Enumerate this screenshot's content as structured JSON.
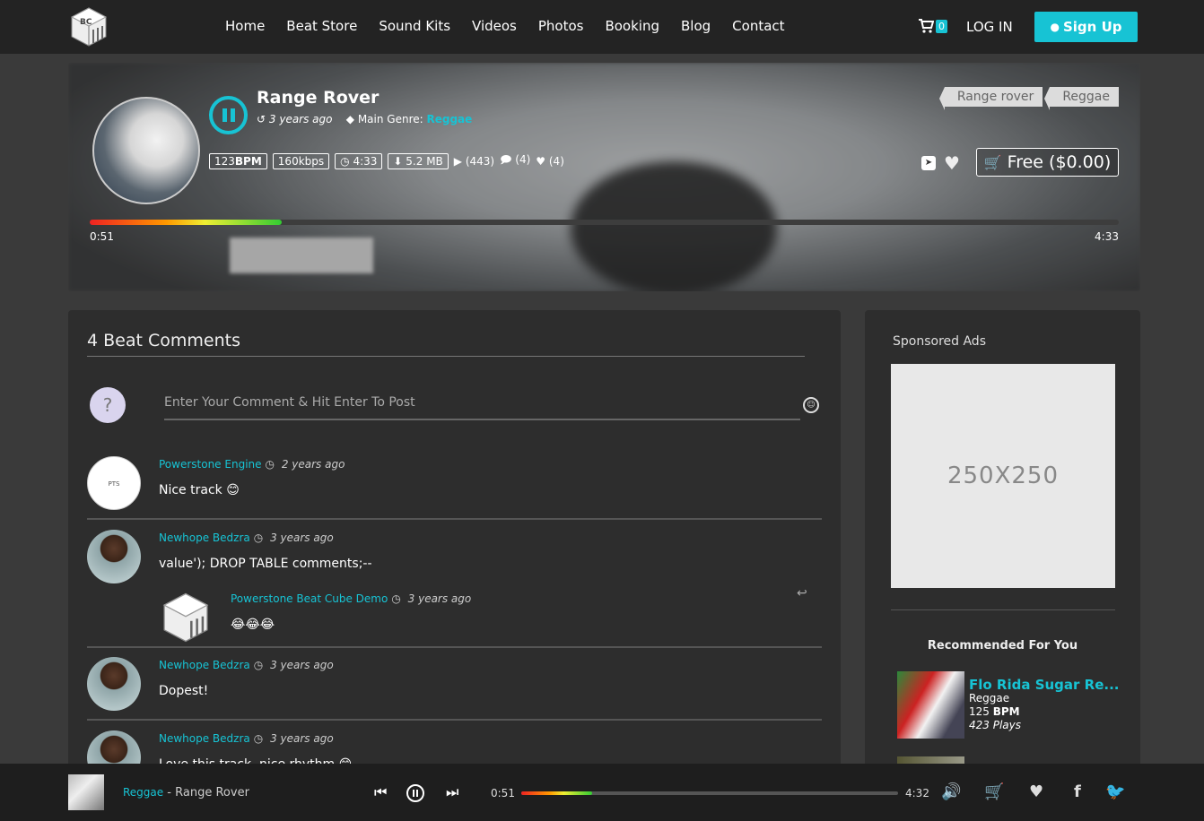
{
  "nav": {
    "links": [
      "Home",
      "Beat Store",
      "Sound Kits",
      "Videos",
      "Photos",
      "Booking",
      "Blog",
      "Contact"
    ],
    "cart_count": "0",
    "login": "LOG IN",
    "signup": "Sign Up",
    "logo_text": "BC"
  },
  "beat": {
    "title": "Range Rover",
    "ago": "3 years ago",
    "genre_label": "Main Genre:",
    "genre": "Reggae",
    "bpm_value": "123",
    "bpm_unit": "BPM",
    "bitrate": "160kbps",
    "duration": "4:33",
    "size": "5.2 MB",
    "plays": "(443)",
    "comments": "(4)",
    "likes": "(4)",
    "tags": [
      "Range rover",
      "Reggae"
    ],
    "price": "Free ($0.00)",
    "current_time": "0:51",
    "total_time": "4:33",
    "progress_fraction": 0.187
  },
  "comments": {
    "heading": "4 Beat Comments",
    "input_placeholder": "Enter Your Comment & Hit Enter To Post",
    "items": [
      {
        "name": "Powerstone Engine",
        "time": "2 years ago",
        "text": "Nice track 😊",
        "avatar": "PTS TECHNOLOGIES"
      },
      {
        "name": "Newhope Bedzra",
        "time": "3 years ago",
        "text": "value'); DROP TABLE comments;--"
      },
      {
        "name": "Newhope Bedzra",
        "time": "3 years ago",
        "text": "Dopest!"
      },
      {
        "name": "Newhope Bedzra",
        "time": "3 years ago",
        "text": "Love this track, nice rhythm 😊"
      }
    ],
    "reply": {
      "name": "Powerstone Beat Cube Demo",
      "time": "3 years ago",
      "text": "😂😂😂"
    }
  },
  "sidebar": {
    "ads_heading": "Sponsored Ads",
    "ad_text": "250X250",
    "rec_heading": "Recommended For You",
    "rec": {
      "title": "Flo Rida Sugar Re...",
      "genre": "Reggae",
      "bpm_value": "125",
      "bpm_unit": "BPM",
      "plays": "423 Plays"
    }
  },
  "player": {
    "genre": "Reggae",
    "separator": "-",
    "title": "Range Rover",
    "current_time": "0:51",
    "total_time": "4:32",
    "progress_fraction": 0.187
  },
  "colors": {
    "accent": "#17c3d4",
    "nav_bg": "#232323",
    "panel_bg": "#2d2d2d"
  }
}
